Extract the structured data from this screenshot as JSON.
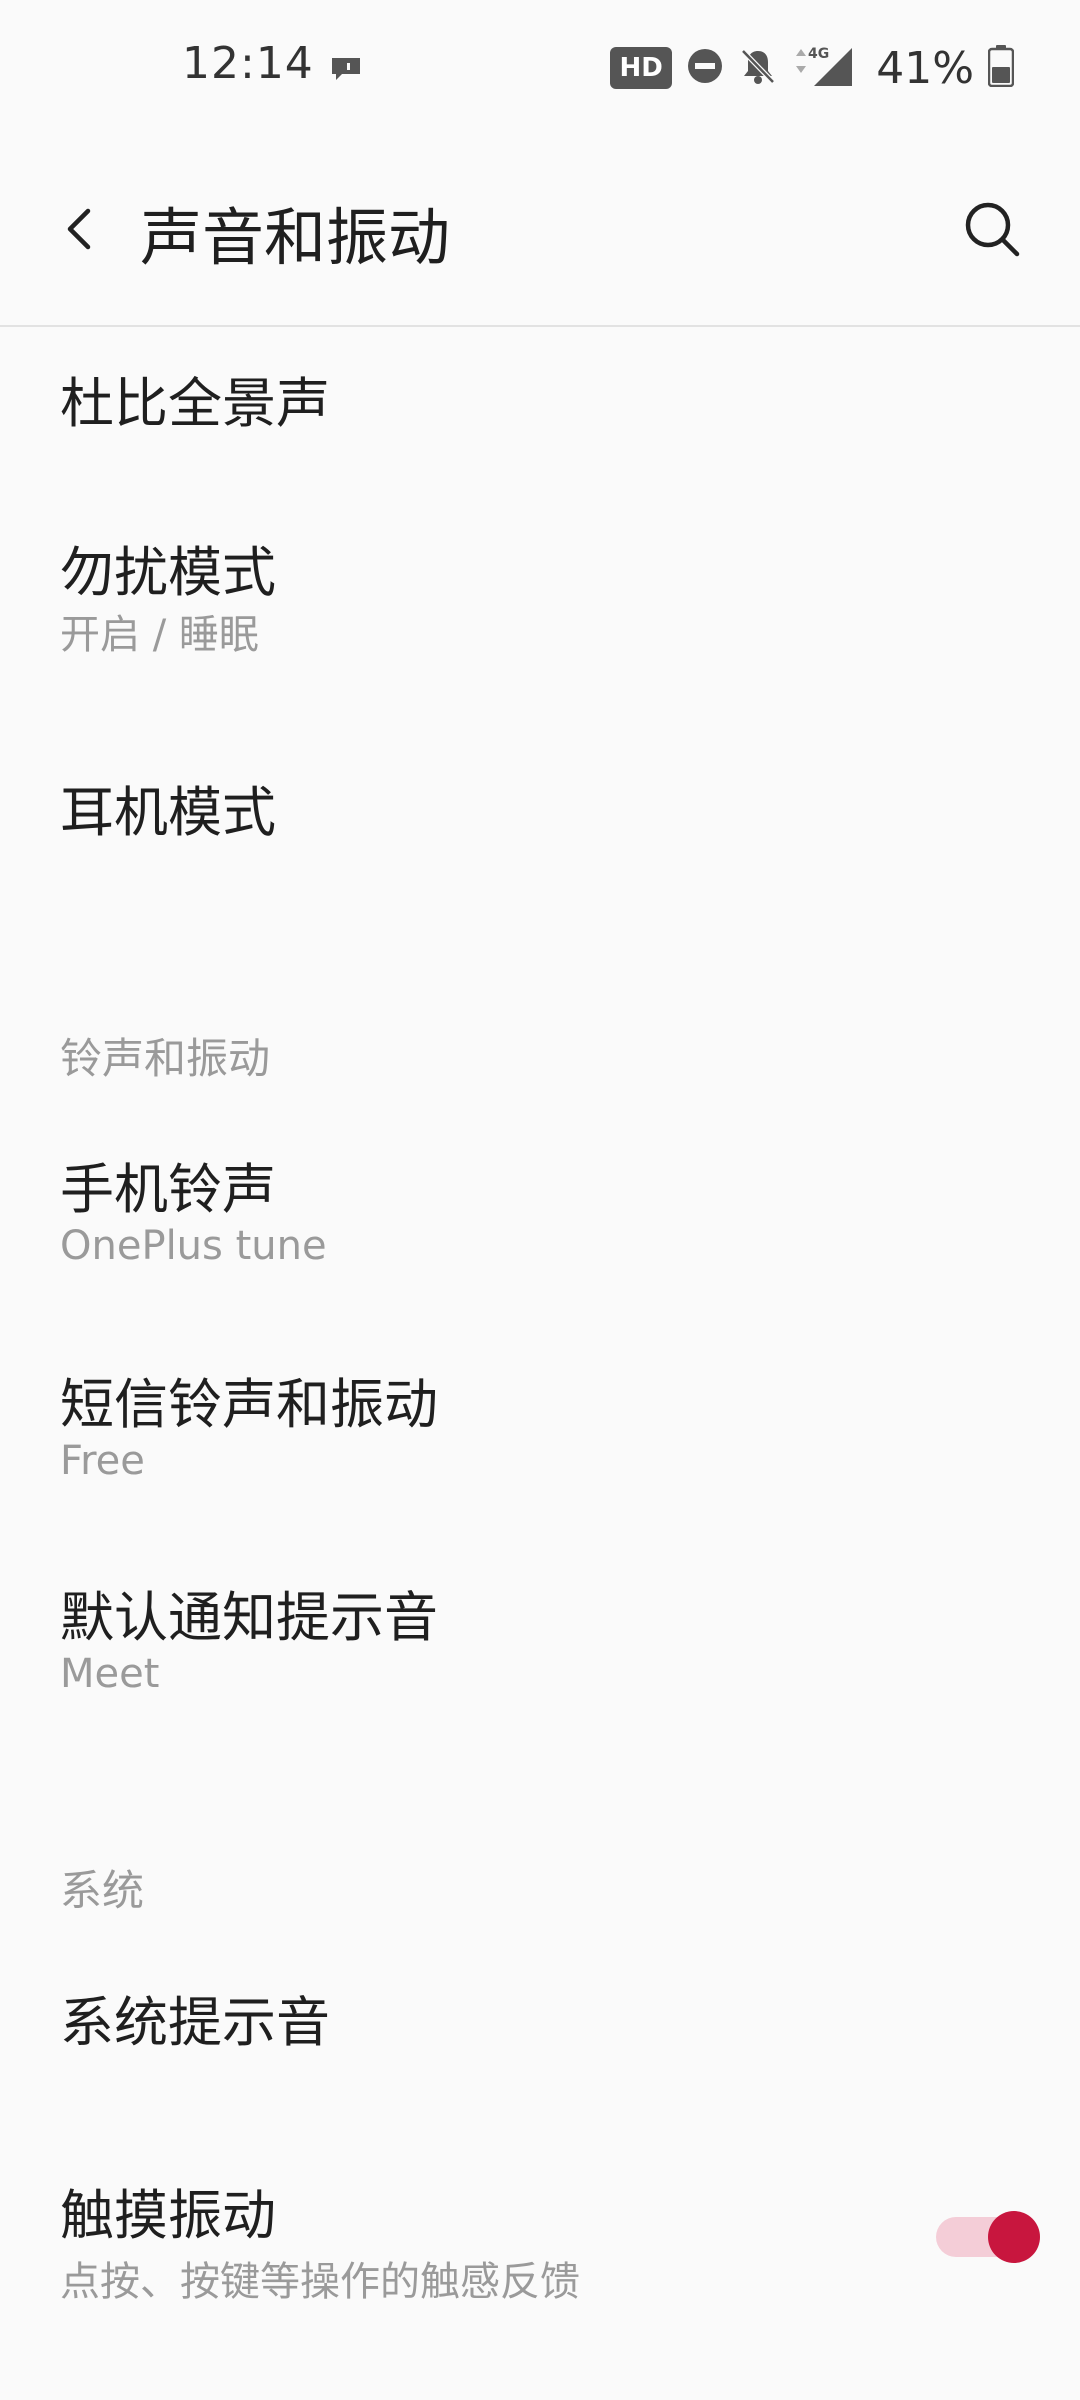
{
  "status_bar": {
    "time": "12:14",
    "hd_badge": "HD",
    "network": "4G",
    "battery": "41%"
  },
  "app_bar": {
    "title": "声音和振动"
  },
  "items": {
    "dolby": {
      "title": "杜比全景声"
    },
    "dnd": {
      "title": "勿扰模式",
      "subtitle": "开启 / 睡眠"
    },
    "earphone": {
      "title": "耳机模式"
    },
    "ringtone": {
      "title": "手机铃声",
      "subtitle": "OnePlus tune"
    },
    "sms": {
      "title": "短信铃声和振动",
      "subtitle": "Free"
    },
    "notification": {
      "title": "默认通知提示音",
      "subtitle": "Meet"
    },
    "system_sound": {
      "title": "系统提示音"
    },
    "haptic": {
      "title": "触摸振动",
      "subtitle": "点按、按键等操作的触感反馈",
      "enabled": true
    }
  },
  "sections": {
    "ring_vibrate": "铃声和振动",
    "system": "系统"
  },
  "colors": {
    "accent": "#c8163e",
    "accent_track": "#f4cdd7",
    "background": "#fafafa",
    "secondary_text": "#9a9a9a"
  }
}
